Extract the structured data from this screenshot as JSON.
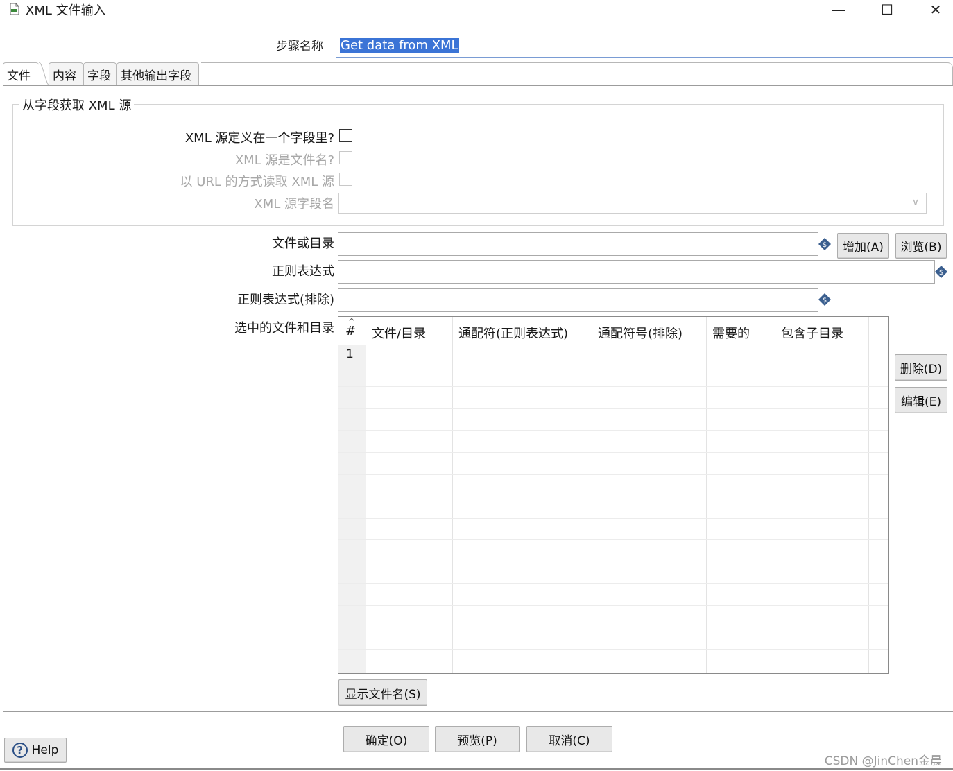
{
  "window": {
    "title": "XML 文件输入",
    "minimize": "—",
    "maximize": "☐",
    "close": "✕"
  },
  "step": {
    "label": "步骤名称",
    "value": "Get data from XML"
  },
  "tabs": [
    {
      "label": "文件"
    },
    {
      "label": "内容"
    },
    {
      "label": "字段"
    },
    {
      "label": "其他输出字段"
    }
  ],
  "source_group": {
    "title": "从字段获取 XML 源",
    "xml_in_field_label": "XML 源定义在一个字段里?",
    "xml_is_filename_label": "XML 源是文件名?",
    "read_as_url_label": "以 URL 的方式读取 XML 源",
    "xml_field_name_label": "XML 源字段名",
    "combo_arrow": "∨"
  },
  "file": {
    "file_or_dir_label": "文件或目录",
    "regex_label": "正则表达式",
    "regex_exclude_label": "正则表达式(排除)",
    "selected_label": "选中的文件和目录",
    "add_button": "增加(A)",
    "browse_button": "浏览(B)",
    "delete_button": "删除(D)",
    "edit_button": "编辑(E)",
    "show_filename_button": "显示文件名(S)"
  },
  "table": {
    "sort_indicator": "^",
    "columns": [
      "#",
      "文件/目录",
      "通配符(正则表达式)",
      "通配符号(排除)",
      "需要的",
      "包含子目录"
    ],
    "rows": [
      {
        "num": "1",
        "cells": [
          "",
          "",
          "",
          "",
          ""
        ]
      }
    ]
  },
  "footer": {
    "ok_button": "确定(O)",
    "preview_button": "预览(P)",
    "cancel_button": "取消(C)",
    "help_icon_glyph": "?",
    "help_button": "Help",
    "watermark": "CSDN @JinChen金晨"
  }
}
